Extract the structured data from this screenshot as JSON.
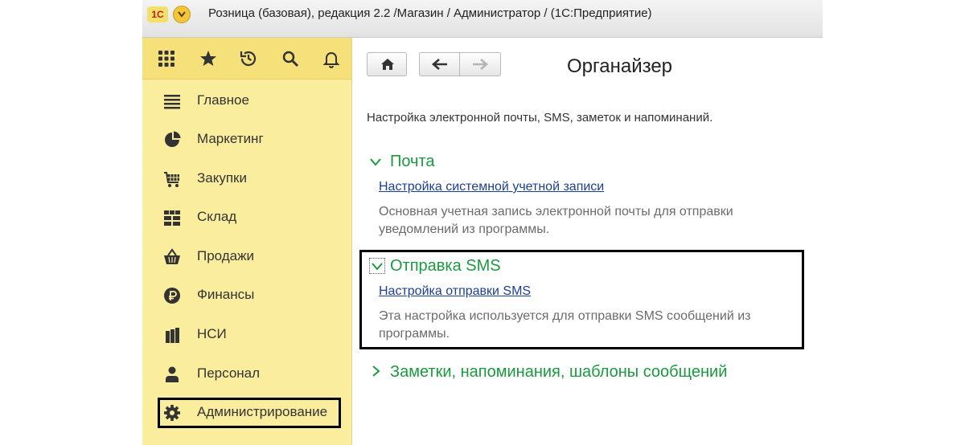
{
  "window": {
    "logo_text": "1С",
    "title": "Розница (базовая), редакция 2.2 /Магазин / Администратор /  (1С:Предприятие)"
  },
  "sidebar": {
    "top_icons": [
      "apps-grid-icon",
      "star-icon",
      "history-icon",
      "search-icon",
      "bell-icon"
    ],
    "items": [
      {
        "label": "Главное",
        "icon": "menu-lines-icon"
      },
      {
        "label": "Маркетинг",
        "icon": "pie-chart-icon"
      },
      {
        "label": "Закупки",
        "icon": "cart-icon"
      },
      {
        "label": "Склад",
        "icon": "warehouse-grid-icon"
      },
      {
        "label": "Продажи",
        "icon": "basket-icon"
      },
      {
        "label": "Финансы",
        "icon": "ruble-coin-icon"
      },
      {
        "label": "НСИ",
        "icon": "books-icon"
      },
      {
        "label": "Персонал",
        "icon": "person-icon"
      },
      {
        "label": "Администрирование",
        "icon": "gear-icon",
        "active": true
      }
    ]
  },
  "main": {
    "title": "Органайзер",
    "description": "Настройка электронной почты, SMS, заметок и напоминаний.",
    "sections": [
      {
        "title": "Почта",
        "expanded": true,
        "link": "Настройка системной учетной записи",
        "note": "Основная учетная запись электронной почты для отправки уведомлений из программы."
      },
      {
        "title": "Отправка SMS",
        "expanded": true,
        "link": "Настройка отправки SMS",
        "note": "Эта настройка используется для отправки SMS сообщений из программы."
      },
      {
        "title": "Заметки, напоминания, шаблоны сообщений",
        "expanded": false
      }
    ]
  },
  "colors": {
    "sidebar_bg": "#fbed9e",
    "section_title": "#1a9a3f",
    "link": "#1c3f94",
    "note": "#6b6b6b"
  }
}
